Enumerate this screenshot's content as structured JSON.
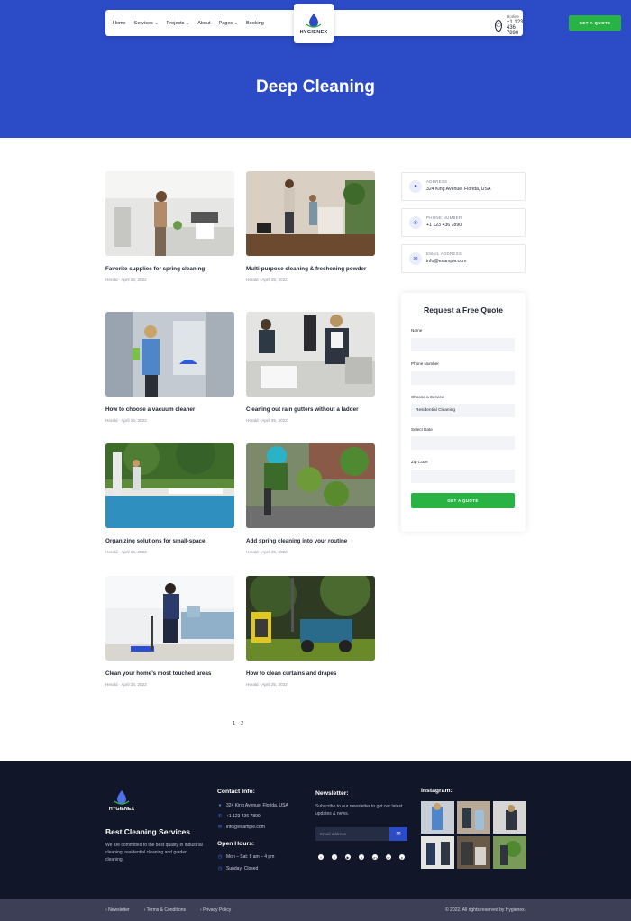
{
  "nav": {
    "items": [
      {
        "label": "Home",
        "dropdown": false
      },
      {
        "label": "Services",
        "dropdown": true
      },
      {
        "label": "Projects",
        "dropdown": true
      },
      {
        "label": "About",
        "dropdown": false
      },
      {
        "label": "Pages",
        "dropdown": true
      },
      {
        "label": "Booking",
        "dropdown": false
      }
    ],
    "logo_text": "HYGIENEX",
    "hotline_label": "Hotline",
    "hotline_number": "+1 123 436 7890",
    "cta_label": "GET A QUOTE"
  },
  "hero": {
    "title": "Deep Cleaning"
  },
  "posts": [
    {
      "title": "Favorite supplies for spring cleaning",
      "meta": "Herald · April 25, 2022"
    },
    {
      "title": "Multi-purpose cleaning & freshening powder",
      "meta": "Herald · April 25, 2022"
    },
    {
      "title": "How to choose a vacuum cleaner",
      "meta": "Herald · April 25, 2022"
    },
    {
      "title": "Cleaning out rain gutters without a ladder",
      "meta": "Herald · April 25, 2022"
    },
    {
      "title": "Organizing solutions for small-space",
      "meta": "Herald · April 25, 2022"
    },
    {
      "title": "Add spring cleaning into your routine",
      "meta": "Herald · April 25, 2022"
    },
    {
      "title": "Clean your home’s most touched areas",
      "meta": "Herald · April 25, 2022"
    },
    {
      "title": "How to clean curtains and drapes",
      "meta": "Herald · April 25, 2022"
    }
  ],
  "pagination": [
    "1",
    "2"
  ],
  "contact_cards": [
    {
      "label": "ADDRESS",
      "value": "324 King Avenue, Florida, USA",
      "icon": "location-icon"
    },
    {
      "label": "PHONE NUMBER",
      "value": "+1 123 436 7890",
      "icon": "phone-icon"
    },
    {
      "label": "EMAIL ADDRESS",
      "value": "info@example.com",
      "icon": "mail-icon"
    }
  ],
  "quote_form": {
    "title": "Request a Free Quote",
    "fields": [
      {
        "label": "Name",
        "value": ""
      },
      {
        "label": "Phone Number",
        "value": ""
      },
      {
        "label": "Choose a Service",
        "value": "Residential Cleaning"
      },
      {
        "label": "Select Date",
        "value": ""
      },
      {
        "label": "Zip Code",
        "value": ""
      }
    ],
    "submit_label": "GET A QUOTE"
  },
  "footer": {
    "logo_text": "HYGIENEX",
    "about_heading": "Best Cleaning Services",
    "about_text": "We are committed to the best quality in industrial cleaning, residential cleaning and garden cleaning.",
    "contact_heading": "Contact Info:",
    "contact_items": [
      {
        "icon": "location-icon",
        "text": "324 King Avenue, Florida, USA"
      },
      {
        "icon": "phone-icon",
        "text": "+1 123 436 7890"
      },
      {
        "icon": "mail-icon",
        "text": "info@example.com"
      }
    ],
    "hours_heading": "Open Hours:",
    "hours_items": [
      {
        "icon": "clock-icon",
        "text": "Mon – Sat: 8 am – 4 pm"
      },
      {
        "icon": "clock-icon",
        "text": "Sunday: Closed"
      }
    ],
    "newsletter_heading": "Newsletter:",
    "newsletter_text": "Subscribe to our newsletter to get our latest updates & news.",
    "email_placeholder": "Email address",
    "socials": [
      "facebook-icon",
      "twitter-icon",
      "youtube-icon",
      "instagram-icon",
      "linkedin-icon",
      "whatsapp-icon",
      "pinterest-icon"
    ],
    "instagram_heading": "Instagram:"
  },
  "bottom_bar": {
    "links": [
      "Newsletter",
      "Terms & Conditions",
      "Privacy Policy"
    ],
    "copyright": "© 2022. All rights reserved by Hygienex."
  },
  "colors": {
    "primary": "#2c4bc7",
    "accent": "#2ab345",
    "footer_bg": "#111729",
    "bottom_bar_bg": "#3c3f56"
  }
}
